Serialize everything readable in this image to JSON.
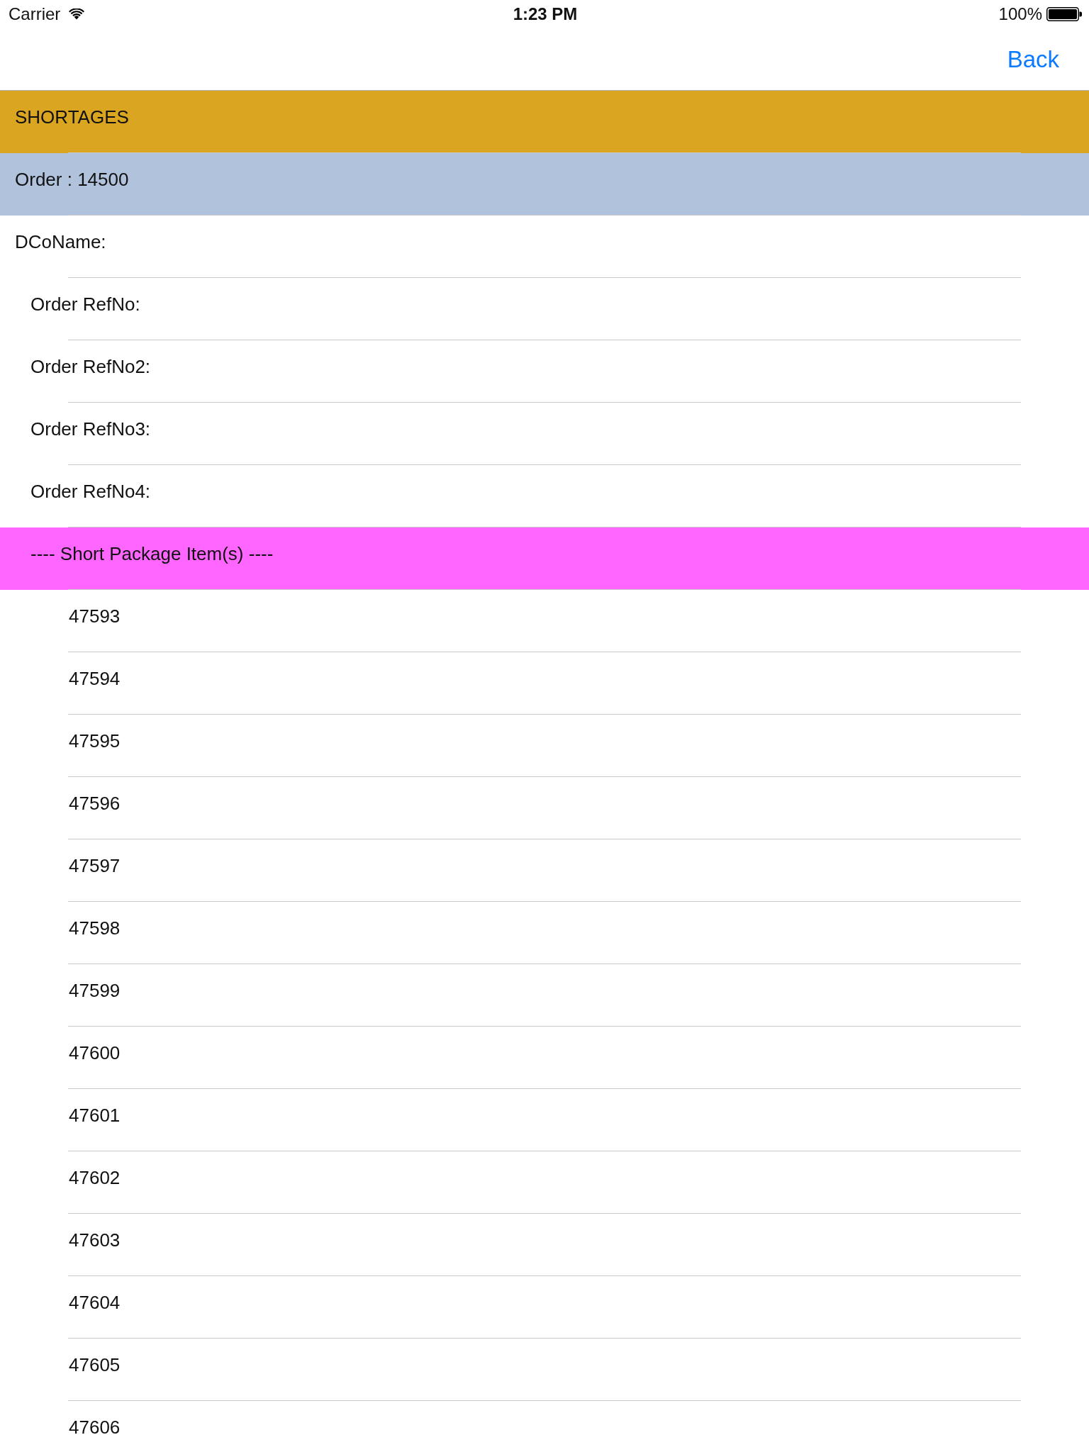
{
  "status_bar": {
    "carrier": "Carrier",
    "time": "1:23 PM",
    "battery": "100%"
  },
  "nav_bar": {
    "back_button": "Back"
  },
  "rows": [
    {
      "kind": "title",
      "text": "SHORTAGES",
      "color": "#daa520"
    },
    {
      "kind": "order",
      "text": "Order : 14500",
      "color": "#b0c2dc"
    },
    {
      "kind": "field",
      "text": "DCoName:"
    },
    {
      "kind": "subfield",
      "text": "Order RefNo:"
    },
    {
      "kind": "subfield",
      "text": "Order RefNo2:"
    },
    {
      "kind": "subfield",
      "text": "Order RefNo3:"
    },
    {
      "kind": "subfield",
      "text": "Order RefNo4:"
    },
    {
      "kind": "section",
      "text": "---- Short Package Item(s) ----",
      "color": "#ff66ff"
    },
    {
      "kind": "item",
      "text": "47593"
    },
    {
      "kind": "item",
      "text": "47594"
    },
    {
      "kind": "item",
      "text": "47595"
    },
    {
      "kind": "item",
      "text": "47596"
    },
    {
      "kind": "item",
      "text": "47597"
    },
    {
      "kind": "item",
      "text": "47598"
    },
    {
      "kind": "item",
      "text": "47599"
    },
    {
      "kind": "item",
      "text": "47600"
    },
    {
      "kind": "item",
      "text": "47601"
    },
    {
      "kind": "item",
      "text": "47602"
    },
    {
      "kind": "item",
      "text": "47603"
    },
    {
      "kind": "item",
      "text": "47604"
    },
    {
      "kind": "item",
      "text": "47605"
    },
    {
      "kind": "item",
      "text": "47606"
    }
  ]
}
